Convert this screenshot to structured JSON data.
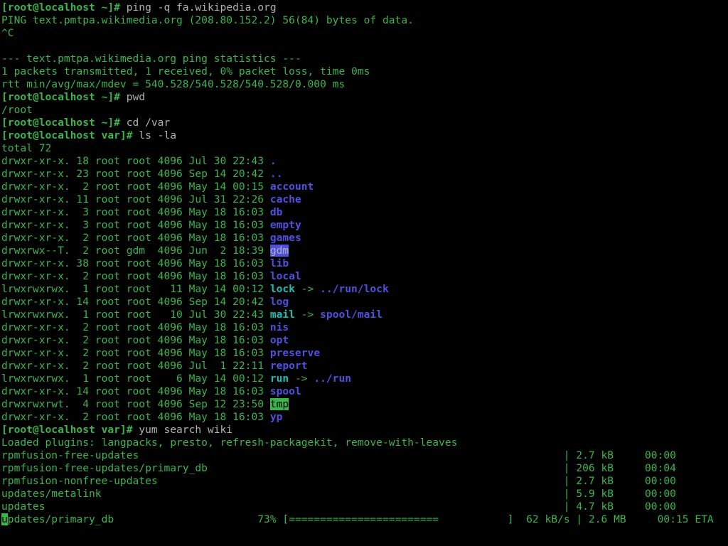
{
  "prompts": {
    "home": "[root@localhost ~]# ",
    "var": "[root@localhost var]# "
  },
  "cmds": {
    "ping": "ping -q fa.wikipedia.org",
    "pwd": "pwd",
    "cd": "cd /var",
    "ls": "ls -la",
    "yum": "yum search wiki"
  },
  "ping": {
    "line1": "PING text.pmtpa.wikimedia.org (208.80.152.2) 56(84) bytes of data.",
    "int": "^C",
    "blank": "",
    "hdr": "--- text.pmtpa.wikimedia.org ping statistics ---",
    "stats": "1 packets transmitted, 1 received, 0% packet loss, time 0ms",
    "rtt": "rtt min/avg/max/mdev = 540.528/540.528/540.528/0.000 ms"
  },
  "pwd_out": "/root",
  "ls": {
    "total": "total 72",
    "rows": [
      {
        "meta": "drwxr-xr-x. 18 root root 4096 Jul 30 22:43 ",
        "name": ".",
        "cls": "db",
        "link": ""
      },
      {
        "meta": "drwxr-xr-x. 23 root root 4096 Sep 14 20:42 ",
        "name": "..",
        "cls": "db",
        "link": ""
      },
      {
        "meta": "drwxr-xr-x.  2 root root 4096 May 14 00:15 ",
        "name": "account",
        "cls": "db",
        "link": ""
      },
      {
        "meta": "drwxr-xr-x. 11 root root 4096 Jul 31 22:26 ",
        "name": "cache",
        "cls": "db",
        "link": ""
      },
      {
        "meta": "drwxr-xr-x.  3 root root 4096 May 18 16:03 ",
        "name": "db",
        "cls": "db",
        "link": ""
      },
      {
        "meta": "drwxr-xr-x.  3 root root 4096 May 18 16:03 ",
        "name": "empty",
        "cls": "db",
        "link": ""
      },
      {
        "meta": "drwxr-xr-x.  2 root root 4096 May 18 16:03 ",
        "name": "games",
        "cls": "db",
        "link": ""
      },
      {
        "meta": "drwxrwx--T.  2 root gdm  4096 Jun  2 18:39 ",
        "name": "gdm",
        "cls": "inv-b",
        "link": ""
      },
      {
        "meta": "drwxr-xr-x. 38 root root 4096 May 18 16:03 ",
        "name": "lib",
        "cls": "db",
        "link": ""
      },
      {
        "meta": "drwxr-xr-x.  2 root root 4096 May 18 16:03 ",
        "name": "local",
        "cls": "db",
        "link": ""
      },
      {
        "meta": "lrwxrwxrwx.  1 root root   11 May 14 00:12 ",
        "name": "lock",
        "cls": "cy",
        "link": " -> ../run/lock"
      },
      {
        "meta": "drwxr-xr-x. 14 root root 4096 Sep 14 20:42 ",
        "name": "log",
        "cls": "db",
        "link": ""
      },
      {
        "meta": "lrwxrwxrwx.  1 root root   10 Jul 30 22:43 ",
        "name": "mail",
        "cls": "cy",
        "link": " -> spool/mail"
      },
      {
        "meta": "drwxr-xr-x.  2 root root 4096 May 18 16:03 ",
        "name": "nis",
        "cls": "db",
        "link": ""
      },
      {
        "meta": "drwxr-xr-x.  2 root root 4096 May 18 16:03 ",
        "name": "opt",
        "cls": "db",
        "link": ""
      },
      {
        "meta": "drwxr-xr-x.  2 root root 4096 May 18 16:03 ",
        "name": "preserve",
        "cls": "db",
        "link": ""
      },
      {
        "meta": "drwxr-xr-x.  2 root root 4096 Jul  1 22:11 ",
        "name": "report",
        "cls": "db",
        "link": ""
      },
      {
        "meta": "lrwxrwxrwx.  1 root root    6 May 14 00:12 ",
        "name": "run",
        "cls": "cy",
        "link": " -> ../run"
      },
      {
        "meta": "drwxr-xr-x. 14 root root 4096 May 18 16:03 ",
        "name": "spool",
        "cls": "db",
        "link": ""
      },
      {
        "meta": "drwxrwxrwt.  4 root root 4096 Sep 12 23:50 ",
        "name": "tmp",
        "cls": "inv-g",
        "link": ""
      },
      {
        "meta": "drwxr-xr-x.  2 root root 4096 May 18 16:03 ",
        "name": "yp",
        "cls": "db",
        "link": ""
      }
    ]
  },
  "yum": {
    "plugins": "Loaded plugins: langpacks, presto, refresh-packagekit, remove-with-leaves",
    "repos": [
      {
        "name": "rpmfusion-free-updates",
        "size": "2.7 kB",
        "time": "00:00"
      },
      {
        "name": "rpmfusion-free-updates/primary_db",
        "size": "206 kB",
        "time": "00:04"
      },
      {
        "name": "rpmfusion-nonfree-updates",
        "size": "2.7 kB",
        "time": "00:00"
      },
      {
        "name": "updates/metalink",
        "size": "5.9 kB",
        "time": "00:00"
      },
      {
        "name": "updates",
        "size": "4.7 kB",
        "time": "00:00"
      }
    ],
    "progress": {
      "name_first_char": "u",
      "name_rest": "pdates/primary_db",
      "pct": "73%",
      "bar_filled": "========================",
      "rate": "62 kB/s",
      "size": "2.6 MB",
      "eta": "00:15 ETA"
    }
  }
}
